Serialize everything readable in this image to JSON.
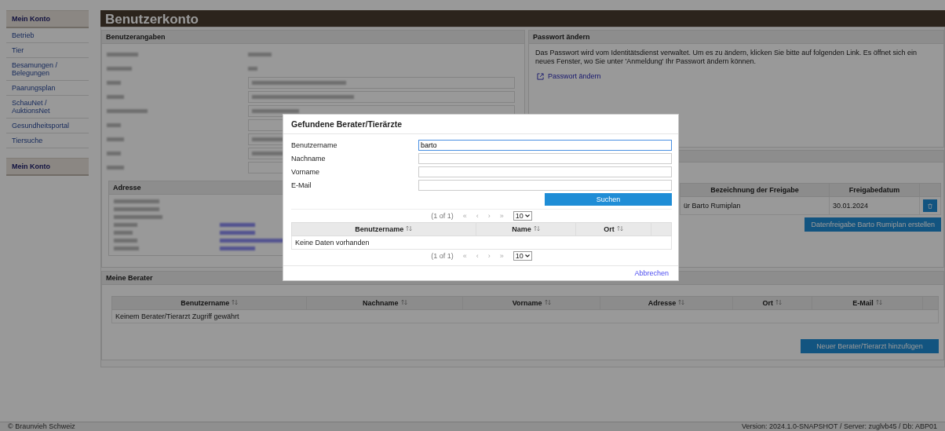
{
  "sidebar": {
    "groups": [
      {
        "title": "Mein Konto",
        "items": [
          "Betrieb",
          "Tier",
          "Besamungen / Belegungen",
          "Paarungsplan",
          "SchauNet / AuktionsNet",
          "Gesundheitsportal",
          "Tiersuche"
        ]
      },
      {
        "title": "Mein Konto"
      }
    ]
  },
  "page_title": "Benutzerkonto",
  "user_panel": {
    "title": "Benutzerangaben",
    "address_title": "Adresse"
  },
  "password_panel": {
    "title": "Passwort ändern",
    "text": "Das Passwort wird vom Identitätsdienst verwaltet. Um es zu ändern, klicken Sie bitte auf folgenden Link. Es öffnet sich ein neues Fenster, wo Sie unter 'Anmeldung' Ihr Passwort ändern können.",
    "link": "Passwort ändern"
  },
  "release_panel": {
    "columns": [
      "Bezeichnung der Freigabe",
      "Freigabedatum"
    ],
    "rows": [
      [
        "ür Barto Rumiplan",
        "30.01.2024"
      ]
    ],
    "create_button": "Datenfreigabe Barto Rumiplan erstellen"
  },
  "advisors_panel": {
    "title": "Meine Berater",
    "columns": [
      "Benutzername",
      "Nachname",
      "Vorname",
      "Adresse",
      "Ort",
      "E-Mail"
    ],
    "empty": "Keinem Berater/Tierarzt Zugriff gewährt",
    "add_button": "Neuer Berater/Tierarzt hinzufügen"
  },
  "footer": {
    "left": "© Braunvieh Schweiz",
    "right": "Version: 2024.1.0-SNAPSHOT / Server: zuglvb45 / Db: ABP01"
  },
  "dialog": {
    "title": "Gefundene Berater/Tierärzte",
    "fields": [
      {
        "label": "Benutzername",
        "value": "barto",
        "focused": true
      },
      {
        "label": "Nachname",
        "focused": false
      },
      {
        "label": "Vorname",
        "focused": false
      },
      {
        "label": "E-Mail",
        "focused": false
      }
    ],
    "search_button": "Suchen",
    "pagers": [
      {
        "status": "(1 of 1)",
        "first": "«",
        "prev": "‹",
        "next": "›",
        "last": "»",
        "rows": "10"
      },
      {
        "status": "(1 of 1)",
        "first": "«",
        "prev": "‹",
        "next": "›",
        "last": "»",
        "rows": "10"
      }
    ],
    "columns": [
      "Benutzername",
      "Name",
      "Ort"
    ],
    "empty": "Keine Daten vorhanden",
    "cancel": "Abbrechen"
  }
}
